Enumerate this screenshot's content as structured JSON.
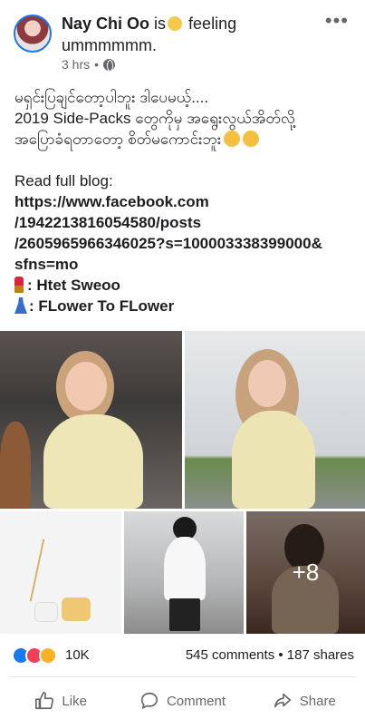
{
  "header": {
    "author": "Nay Chi Oo",
    "activity_prefix": "is",
    "activity": "feeling ummmmmm.",
    "time": "3 hrs",
    "icons": [
      "avatar",
      "smile-emoji-icon",
      "globe-icon",
      "more-options-icon"
    ]
  },
  "post": {
    "line1": "မရှင်းပြချင်တော့ပါဘူး ဒါပေမယ့်....",
    "line2": "2019 Side-Packs တွေကိုမှ အရွေးလွယ်အိတ်လို့",
    "line3": "အပြောခံရတာတော့ စိတ်မကောင်းဘူး",
    "read_label": "Read full blog:",
    "link1": "https://www.facebook.com",
    "link2": "/1942213816054580/posts",
    "link3": "/2605965966346025?s=100003338399000&",
    "link4": "sfns=mo",
    "credit1": ": Htet Sweoo",
    "credit2": ": FLower To FLower"
  },
  "photos": {
    "more_count": "+8"
  },
  "stats": {
    "reactions": "10K",
    "comments_shares": "545 comments • 187 shares"
  },
  "actions": {
    "like": "Like",
    "comment": "Comment",
    "share": "Share"
  }
}
